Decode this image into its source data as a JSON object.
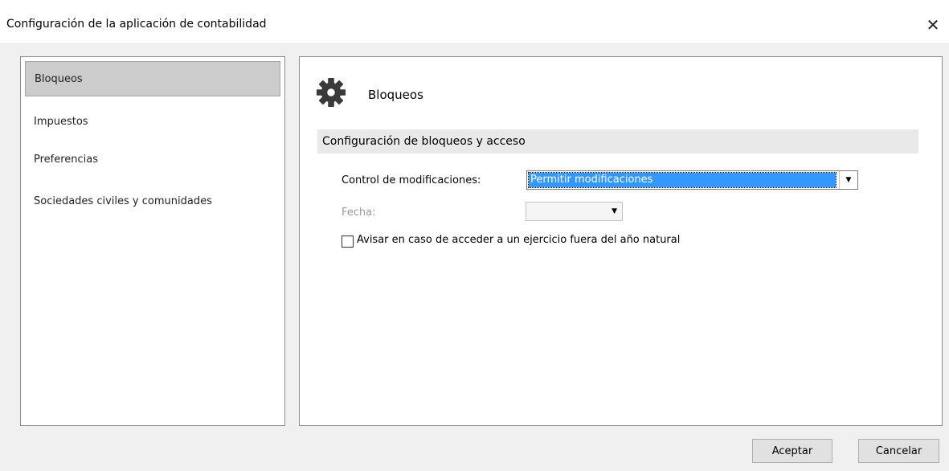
{
  "window": {
    "title": "Configuración de la aplicación de contabilidad",
    "close_glyph": "✕"
  },
  "sidebar": {
    "items": [
      {
        "label": "Bloqueos",
        "selected": true
      },
      {
        "label": "Impuestos",
        "selected": false
      },
      {
        "label": "Preferencias",
        "selected": false
      },
      {
        "label": "Sociedades civiles y comunidades",
        "selected": false
      }
    ]
  },
  "panel": {
    "icon": "gear-icon",
    "title": "Bloqueos",
    "section_header": "Configuración de bloqueos y acceso",
    "control_label": "Control de modificaciones:",
    "control_value": "Permitir modificaciones",
    "fecha_label": "Fecha:",
    "fecha_value": "",
    "checkbox_label": "Avisar en caso de acceder a un ejercicio fuera del año natural",
    "checkbox_checked": false
  },
  "footer": {
    "accept_label": "Aceptar",
    "cancel_label": "Cancelar"
  },
  "colors": {
    "selection": "#3399ff",
    "sidebar_selected": "#cccccc",
    "dialog_bg": "#f0f0f0"
  }
}
